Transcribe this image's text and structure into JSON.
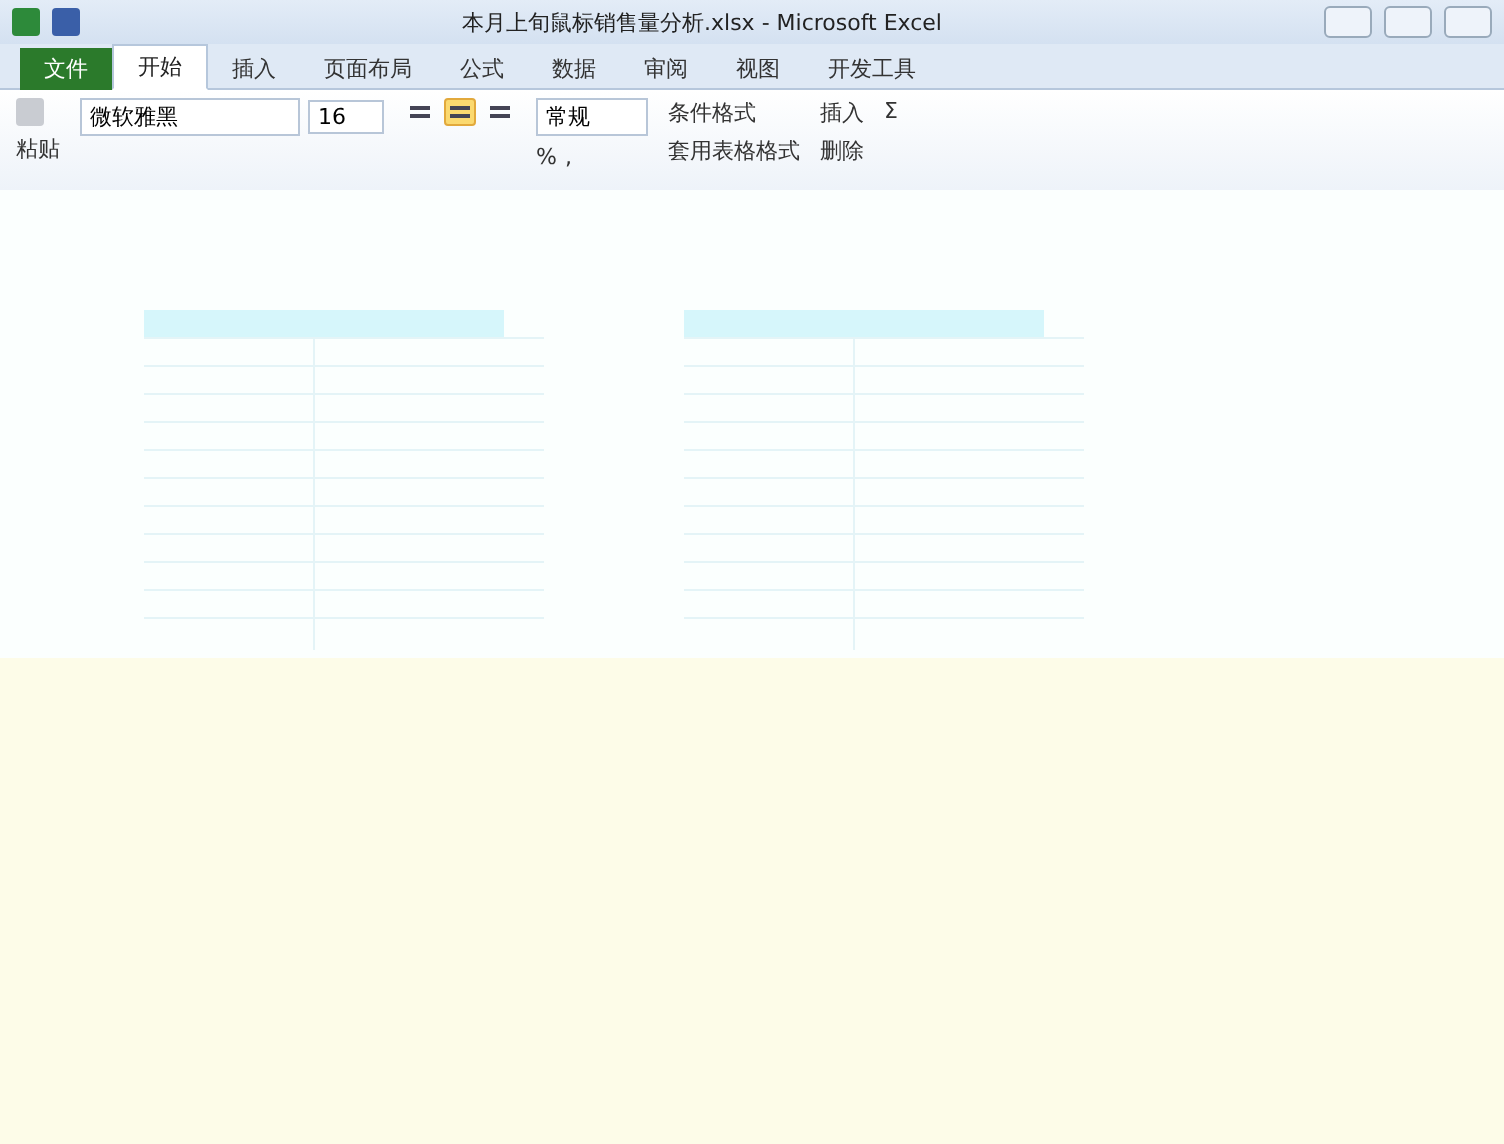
{
  "window": {
    "title": "本月上旬鼠标销售量分析.xlsx - Microsoft Excel"
  },
  "tabs": [
    {
      "label": "文件",
      "kind": "file",
      "selected": false
    },
    {
      "label": "开始",
      "kind": "tab",
      "selected": true
    },
    {
      "label": "插入",
      "kind": "tab",
      "selected": false
    },
    {
      "label": "页面布局",
      "kind": "tab",
      "selected": false
    },
    {
      "label": "公式",
      "kind": "tab",
      "selected": false
    },
    {
      "label": "数据",
      "kind": "tab",
      "selected": false
    },
    {
      "label": "审阅",
      "kind": "tab",
      "selected": false
    },
    {
      "label": "视图",
      "kind": "tab",
      "selected": false
    },
    {
      "label": "开发工具",
      "kind": "tab",
      "selected": false
    }
  ],
  "ribbon": {
    "paste": "粘贴",
    "font_name": "微软雅黑",
    "font_size": "16",
    "number_format": "常规",
    "percent": "%",
    "comma": ",",
    "styles": [
      "条件格式",
      "套用表格格式"
    ],
    "cells": [
      "插入",
      "删除"
    ],
    "sum": "Σ",
    "align_center_selected": true
  }
}
